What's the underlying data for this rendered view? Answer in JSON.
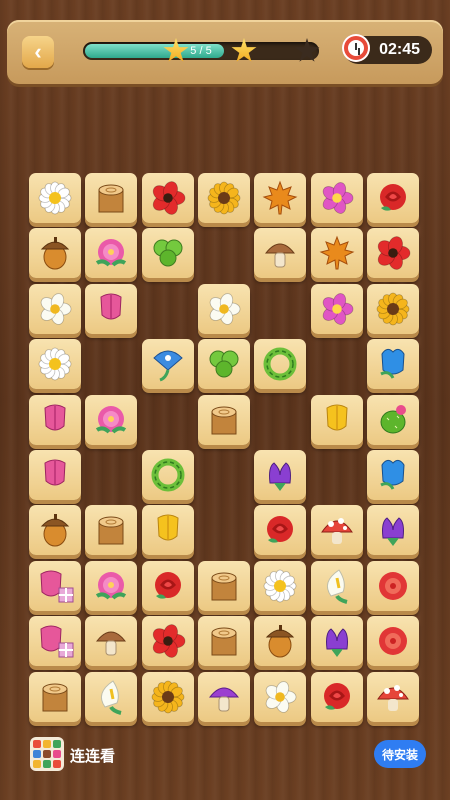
{
  "header": {
    "back_label": "‹",
    "progress_text": "5 / 5",
    "progress_fraction": 0.6,
    "stars_earned": 2,
    "stars_total": 3,
    "timer": "02:45"
  },
  "board": {
    "tiles": [
      {
        "icon": "daisy-icon",
        "row": 0,
        "col": 0
      },
      {
        "icon": "stump-icon",
        "row": 0,
        "col": 1
      },
      {
        "icon": "poppy-icon",
        "row": 0,
        "col": 2
      },
      {
        "icon": "sunflower-icon",
        "row": 0,
        "col": 3
      },
      {
        "icon": "maple-leaf-icon",
        "row": 0,
        "col": 4
      },
      {
        "icon": "pink-flower-icon",
        "row": 0,
        "col": 5
      },
      {
        "icon": "rose-icon",
        "row": 0,
        "col": 6
      },
      {
        "icon": "acorn-icon",
        "row": 1,
        "col": 0
      },
      {
        "icon": "peony-icon",
        "row": 1,
        "col": 1
      },
      {
        "icon": "clover-icon",
        "row": 1,
        "col": 2
      },
      {
        "icon": "mushroom-icon",
        "row": 1,
        "col": 4
      },
      {
        "icon": "maple-leaf-icon",
        "row": 1,
        "col": 5
      },
      {
        "icon": "poppy-icon",
        "row": 1,
        "col": 6
      },
      {
        "icon": "white-flower-icon",
        "row": 2,
        "col": 0
      },
      {
        "icon": "tulip-icon",
        "row": 2,
        "col": 1
      },
      {
        "icon": "white-flower-icon",
        "row": 2,
        "col": 3
      },
      {
        "icon": "pink-flower-icon",
        "row": 2,
        "col": 5
      },
      {
        "icon": "sunflower-icon",
        "row": 2,
        "col": 6
      },
      {
        "icon": "daisy-icon",
        "row": 3,
        "col": 0
      },
      {
        "icon": "morning-glory-icon",
        "row": 3,
        "col": 2
      },
      {
        "icon": "clover-icon",
        "row": 3,
        "col": 3
      },
      {
        "icon": "wreath-icon",
        "row": 3,
        "col": 4
      },
      {
        "icon": "blue-tulip-icon",
        "row": 3,
        "col": 6
      },
      {
        "icon": "tulip-icon",
        "row": 4,
        "col": 0
      },
      {
        "icon": "peony-icon",
        "row": 4,
        "col": 1
      },
      {
        "icon": "stump-icon",
        "row": 4,
        "col": 3
      },
      {
        "icon": "yellow-tulip-icon",
        "row": 4,
        "col": 5
      },
      {
        "icon": "cactus-icon",
        "row": 4,
        "col": 6
      },
      {
        "icon": "tulip-icon",
        "row": 5,
        "col": 0
      },
      {
        "icon": "wreath-icon",
        "row": 5,
        "col": 2
      },
      {
        "icon": "purple-flower-icon",
        "row": 5,
        "col": 4
      },
      {
        "icon": "blue-tulip-icon",
        "row": 5,
        "col": 6
      },
      {
        "icon": "acorn-icon",
        "row": 6,
        "col": 0
      },
      {
        "icon": "stump-icon",
        "row": 6,
        "col": 1
      },
      {
        "icon": "yellow-tulip-icon",
        "row": 6,
        "col": 2
      },
      {
        "icon": "rose-icon",
        "row": 6,
        "col": 4
      },
      {
        "icon": "toadstool-icon",
        "row": 6,
        "col": 5
      },
      {
        "icon": "purple-flower-icon",
        "row": 6,
        "col": 6
      },
      {
        "icon": "tulip-gift-icon",
        "row": 7,
        "col": 0
      },
      {
        "icon": "peony-icon",
        "row": 7,
        "col": 1
      },
      {
        "icon": "rose-icon",
        "row": 7,
        "col": 2
      },
      {
        "icon": "stump-icon",
        "row": 7,
        "col": 3
      },
      {
        "icon": "daisy-icon",
        "row": 7,
        "col": 4
      },
      {
        "icon": "calla-lily-icon",
        "row": 7,
        "col": 5
      },
      {
        "icon": "red-bloom-icon",
        "row": 7,
        "col": 6
      },
      {
        "icon": "tulip-gift-icon",
        "row": 8,
        "col": 0
      },
      {
        "icon": "mushroom-icon",
        "row": 8,
        "col": 1
      },
      {
        "icon": "poppy-icon",
        "row": 8,
        "col": 2
      },
      {
        "icon": "stump-icon",
        "row": 8,
        "col": 3
      },
      {
        "icon": "acorn-icon",
        "row": 8,
        "col": 4
      },
      {
        "icon": "purple-flower-icon",
        "row": 8,
        "col": 5
      },
      {
        "icon": "red-bloom-icon",
        "row": 8,
        "col": 6
      },
      {
        "icon": "stump-icon",
        "row": 9,
        "col": 0
      },
      {
        "icon": "calla-lily-icon",
        "row": 9,
        "col": 1
      },
      {
        "icon": "sunflower-icon",
        "row": 9,
        "col": 2
      },
      {
        "icon": "purple-mushroom-icon",
        "row": 9,
        "col": 3
      },
      {
        "icon": "white-flower-icon",
        "row": 9,
        "col": 4
      },
      {
        "icon": "rose-icon",
        "row": 9,
        "col": 5
      },
      {
        "icon": "toadstool-icon",
        "row": 9,
        "col": 6
      }
    ]
  },
  "footer": {
    "app_name": "连连看",
    "install_label": "待安装"
  }
}
